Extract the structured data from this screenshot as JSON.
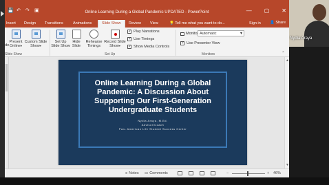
{
  "window": {
    "title": "Online Learning During a Global Pandemic UPDATED - PowerPoint",
    "controls": {
      "minimize": "—",
      "restore": "▢",
      "close": "✕"
    }
  },
  "quick_access": {
    "save_icon": "💾",
    "undo_icon": "↶",
    "redo_icon": "↷",
    "present_icon": "▣"
  },
  "tabs": [
    {
      "label": "Insert"
    },
    {
      "label": "Design"
    },
    {
      "label": "Transitions"
    },
    {
      "label": "Animations"
    },
    {
      "label": "Slide Show",
      "active": true
    },
    {
      "label": "Review"
    },
    {
      "label": "View"
    }
  ],
  "tell_me": "Tell me what you want to do...",
  "sign_in": "Sign in",
  "share": "Share",
  "ribbon": {
    "partial_left": "ide",
    "present_online": "Present\nOnline",
    "custom_show": "Custom Slide\nShow",
    "setup_show": "Set Up\nSlide Show",
    "hide_slide": "Hide\nSlide",
    "rehearse": "Rehearse\nTimings",
    "record": "Record Slide\nShow",
    "play_narrations": "Play Narrations",
    "use_timings": "Use Timings",
    "show_media_controls": "Show Media Controls",
    "monitor_label": "Monitor:",
    "monitor_value": "Automatic",
    "presenter_view": "Use Presenter View",
    "groups": {
      "slide_show": "Slide Show",
      "set_up": "Set Up",
      "monitors": "Monitors"
    }
  },
  "slide": {
    "title_lines": [
      "Online Learning During a Global",
      "Pandemic: A Discussion About",
      "Supporting Our First-Generation",
      "Undergraduate Students"
    ],
    "presenter": "Nydia Araya, M.Ed.",
    "role": "Advisor/Coach",
    "org": "Pan- American Life Student Success Center",
    "colors": {
      "background": "#1b3a5c",
      "frame": "#3b79b7"
    }
  },
  "status": {
    "notes": "Notes",
    "comments": "Comments",
    "zoom_minus": "−",
    "zoom_plus": "+",
    "zoom": "46%"
  },
  "video": {
    "participant_name": "Nydia Araya"
  },
  "colors": {
    "accent": "#b7472a"
  }
}
